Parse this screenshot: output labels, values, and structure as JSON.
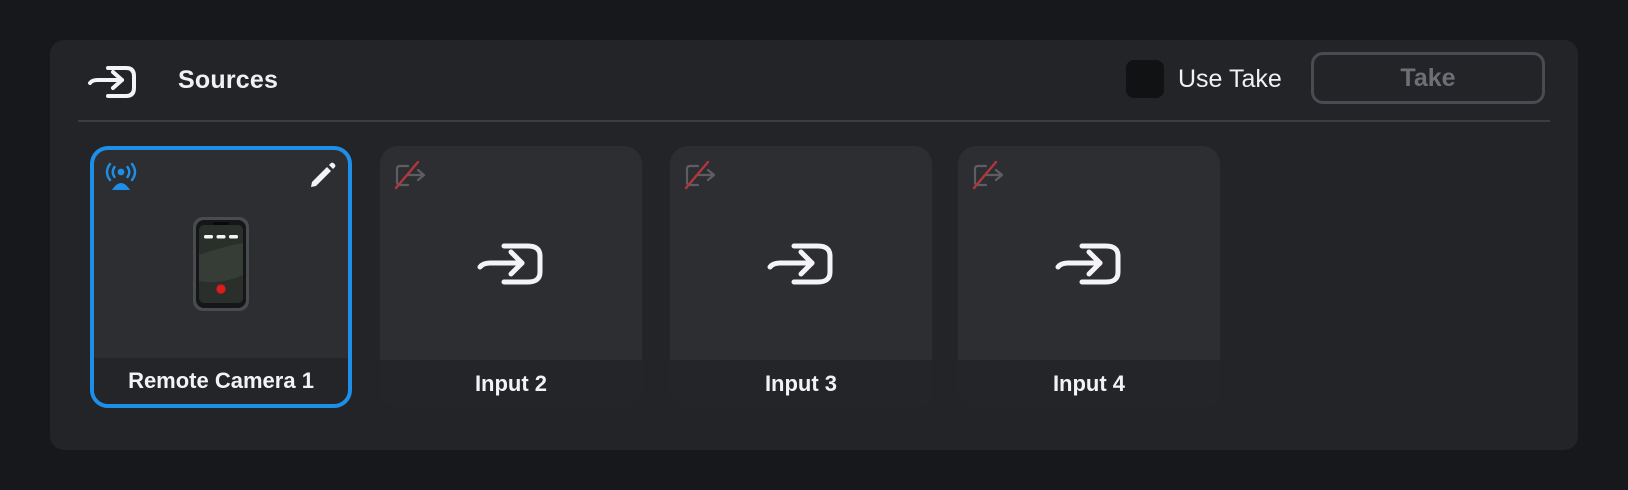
{
  "header": {
    "icon": "input-source-icon",
    "title": "Sources",
    "use_take_label": "Use Take",
    "use_take_checked": false,
    "take_button_label": "Take",
    "take_button_enabled": false
  },
  "sources": [
    {
      "label": "Remote Camera 1",
      "selected": true,
      "status_icon": "broadcasting-icon",
      "status_color": "#1e8fe8",
      "has_edit": true,
      "preview_icon": "phone-camera-icon"
    },
    {
      "label": "Input 2",
      "selected": false,
      "status_icon": "no-signal-icon",
      "status_color": "#b3353d",
      "has_edit": false,
      "preview_icon": "input-source-icon"
    },
    {
      "label": "Input 3",
      "selected": false,
      "status_icon": "no-signal-icon",
      "status_color": "#b3353d",
      "has_edit": false,
      "preview_icon": "input-source-icon"
    },
    {
      "label": "Input 4",
      "selected": false,
      "status_icon": "no-signal-icon",
      "status_color": "#b3353d",
      "has_edit": false,
      "preview_icon": "input-source-icon"
    }
  ],
  "colors": {
    "accent": "#1e8fe8",
    "no_signal": "#b3353d",
    "record_dot": "#e01b1b"
  }
}
